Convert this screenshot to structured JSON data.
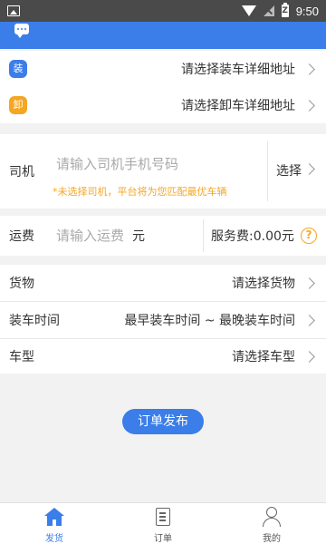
{
  "status_bar": {
    "time": "9:50",
    "battery_label": "Z"
  },
  "load_address": {
    "badge": "装",
    "badge_color": "#3b7de9",
    "text": "请选择装车详细地址"
  },
  "unload_address": {
    "badge": "卸",
    "badge_color": "#f5a623",
    "text": "请选择卸车详细地址"
  },
  "driver": {
    "label": "司机",
    "placeholder": "请输入司机手机号码",
    "note": "*未选择司机，平台将为您匹配最优车辆",
    "select_label": "选择"
  },
  "freight": {
    "label": "运费",
    "placeholder": "请输入运费",
    "unit": "元",
    "service_fee": "服务费:0.00元"
  },
  "goods": {
    "label": "货物",
    "value": "请选择货物"
  },
  "load_time": {
    "label": "装车时间",
    "value": "最早装车时间 ~ 最晚装车时间"
  },
  "vehicle_type": {
    "label": "车型",
    "value": "请选择车型"
  },
  "publish_button": "订单发布",
  "tabs": [
    {
      "label": "发货",
      "icon": "home-icon",
      "active": true
    },
    {
      "label": "订单",
      "icon": "order-icon",
      "active": false
    },
    {
      "label": "我的",
      "icon": "user-icon",
      "active": false
    }
  ],
  "colors": {
    "accent": "#3b7de9",
    "warning": "#f5a623"
  }
}
